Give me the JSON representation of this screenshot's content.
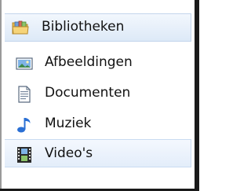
{
  "nav": {
    "library": {
      "label": "Bibliotheken",
      "icon": "libraries-folder-icon"
    },
    "items": [
      {
        "label": "Afbeeldingen",
        "icon": "pictures-icon"
      },
      {
        "label": "Documenten",
        "icon": "documents-icon"
      },
      {
        "label": "Muziek",
        "icon": "music-note-icon"
      },
      {
        "label": "Video's",
        "icon": "film-icon",
        "selected": true
      }
    ]
  },
  "colors": {
    "header_bg": "#e6effa",
    "selected_bg": "#e9f1fc",
    "folder": "#f1c75a",
    "music": "#2a6fd4",
    "film": "#2b2b2b"
  }
}
